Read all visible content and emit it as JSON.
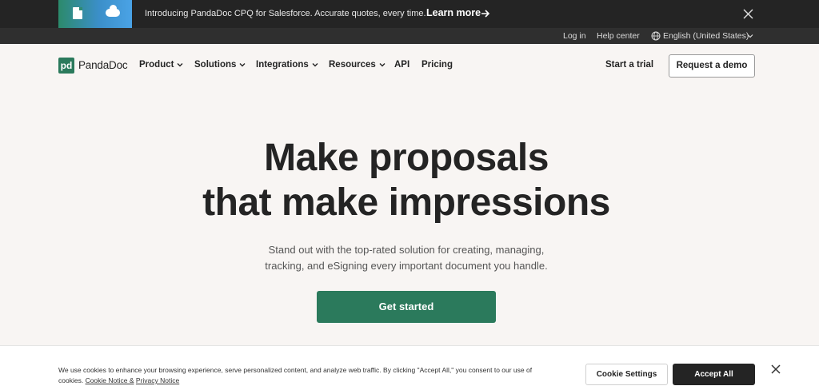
{
  "announcement": {
    "text": "Introducing PandaDoc CPQ for Salesforce. Accurate quotes, every time.",
    "link_label": "Learn more"
  },
  "utility": {
    "login": "Log in",
    "help": "Help center",
    "language": "English (United States)"
  },
  "nav": {
    "logo": "PandaDoc",
    "logo_mark": "pd",
    "items": [
      "Product",
      "Solutions",
      "Integrations",
      "Resources",
      "API",
      "Pricing"
    ],
    "start_trial": "Start a trial",
    "request_demo": "Request a demo"
  },
  "hero": {
    "title_line1": "Make proposals",
    "title_line2": "that make impressions",
    "subtitle_line1": "Stand out with the top-rated solution for creating, managing,",
    "subtitle_line2": "tracking, and eSigning every important document you handle.",
    "cta": "Get started"
  },
  "cookie": {
    "text_line1": "We use cookies to enhance your browsing experience, serve personalized content, and analyze web traffic. By clicking \"Accept All,\" you consent to our use of",
    "text_line2_prefix": "cookies.",
    "cookie_notice": "Cookie Notice &",
    "privacy_notice": "Privacy Notice",
    "settings": "Cookie Settings",
    "accept": "Accept All"
  },
  "colors": {
    "brand_green": "#2b7a5c",
    "dark": "#242424",
    "background": "#f8f5f3"
  }
}
